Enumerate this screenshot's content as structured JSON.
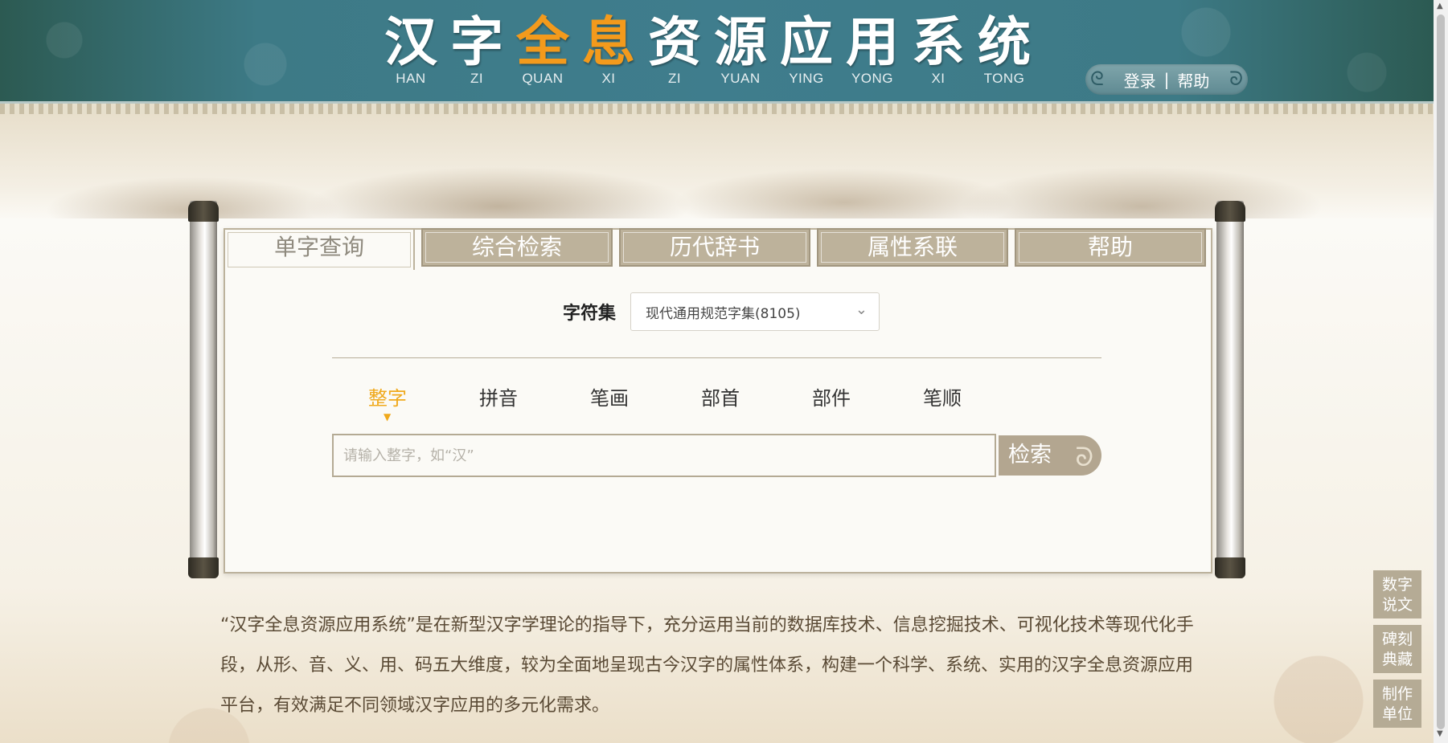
{
  "header": {
    "title_chars": [
      {
        "char": "汉",
        "pinyin": "HAN",
        "highlight": false
      },
      {
        "char": "字",
        "pinyin": "ZI",
        "highlight": false
      },
      {
        "char": "全",
        "pinyin": "QUAN",
        "highlight": true
      },
      {
        "char": "息",
        "pinyin": "XI",
        "highlight": true
      },
      {
        "char": "资",
        "pinyin": "ZI",
        "highlight": false
      },
      {
        "char": "源",
        "pinyin": "YUAN",
        "highlight": false
      },
      {
        "char": "应",
        "pinyin": "YING",
        "highlight": false
      },
      {
        "char": "用",
        "pinyin": "YONG",
        "highlight": false
      },
      {
        "char": "系",
        "pinyin": "XI",
        "highlight": false
      },
      {
        "char": "统",
        "pinyin": "TONG",
        "highlight": false
      }
    ],
    "links": {
      "login": "登录",
      "separator": "|",
      "help": "帮助"
    }
  },
  "tabs": [
    "单字查询",
    "综合检索",
    "历代辞书",
    "属性系联",
    "帮助"
  ],
  "active_tab": 0,
  "charset": {
    "label": "字符集",
    "selected": "现代通用规范字集(8105)"
  },
  "modes": [
    "整字",
    "拼音",
    "笔画",
    "部首",
    "部件",
    "笔顺"
  ],
  "active_mode": 0,
  "search": {
    "placeholder": "请输入整字，如“汉”",
    "value": "",
    "button": "检索"
  },
  "description": "“汉字全息资源应用系统”是在新型汉字学理论的指导下，充分运用当前的数据库技术、信息挖掘技术、可视化技术等现代化手段，从形、音、义、用、码五大维度，较为全面地呈现古今汉字的属性体系，构建一个科学、系统、实用的汉字全息资源应用平台，有效满足不同领域汉字应用的多元化需求。",
  "side_buttons": [
    {
      "line1": "数字",
      "line2": "说文"
    },
    {
      "line1": "碑刻",
      "line2": "典藏"
    },
    {
      "line1": "制作",
      "line2": "单位"
    }
  ],
  "colors": {
    "accent": "#f0a91c",
    "tab_bg": "#bdb29b",
    "header_bg": "#3f7d8d"
  }
}
